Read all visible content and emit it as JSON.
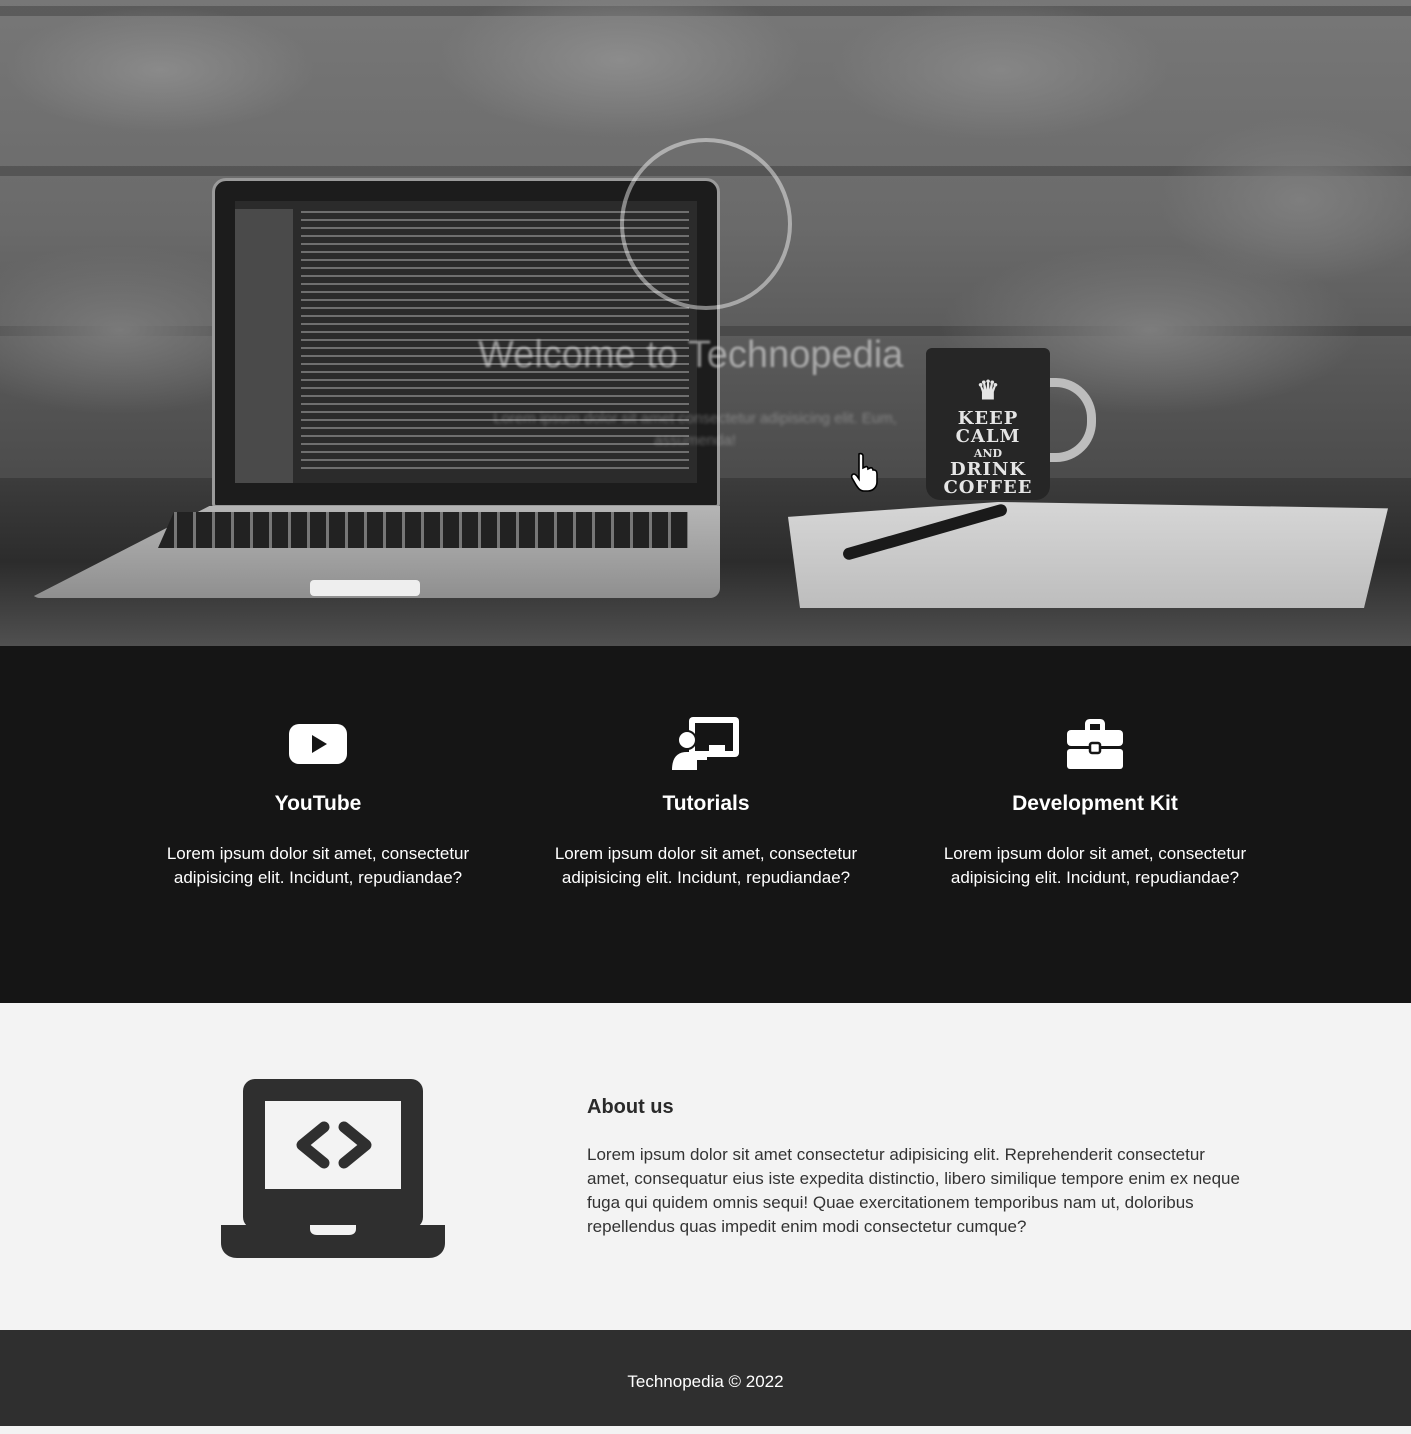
{
  "hero": {
    "title": "Welcome to Technopedia",
    "subtitle": "Lorem ipsum dolor sit amet consectetur adipisicing elit. Eum, assumenda!",
    "mug_crown": "♛",
    "mug_text_1": "KEEP",
    "mug_text_2": "CALM",
    "mug_text_3": "AND",
    "mug_text_4": "DRINK",
    "mug_text_5": "COFFEE"
  },
  "features": [
    {
      "icon": "youtube-icon",
      "title": "YouTube",
      "text": "Lorem ipsum dolor sit amet, consectetur adipisicing elit. Incidunt, repudiandae?"
    },
    {
      "icon": "chalkboard-teacher-icon",
      "title": "Tutorials",
      "text": "Lorem ipsum dolor sit amet, consectetur adipisicing elit. Incidunt, repudiandae?"
    },
    {
      "icon": "toolbox-icon",
      "title": "Development Kit",
      "text": "Lorem ipsum dolor sit amet, consectetur adipisicing elit. Incidunt, repudiandae?"
    }
  ],
  "about": {
    "icon": "laptop-code-icon",
    "title": "About us",
    "text": "Lorem ipsum dolor sit amet consectetur adipisicing elit. Reprehenderit consectetur amet, consequatur eius iste expedita distinctio, libero similique tempore enim ex neque fuga qui quidem omnis sequi! Quae exercitationem temporibus nam ut, doloribus repellendus quas impedit enim modi consectetur cumque?"
  },
  "footer": {
    "text": "Technopedia © 2022"
  },
  "colors": {
    "features_bg": "#151515",
    "about_bg": "#f3f3f3",
    "footer_bg": "#2f2f2f",
    "icon_dark": "#2f2f2f"
  }
}
